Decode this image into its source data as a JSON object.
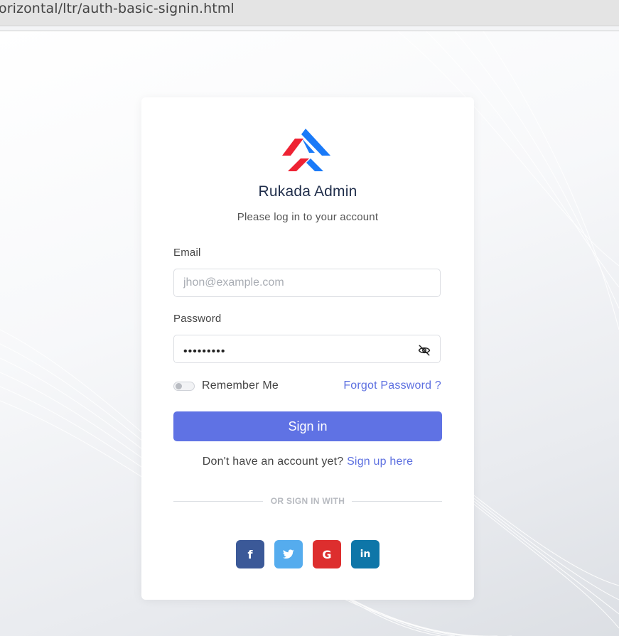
{
  "browser": {
    "url_fragment": "orizontal/ltr/auth-basic-signin.html"
  },
  "brand": {
    "name": "Rukada Admin",
    "tagline": "Please log in to your account",
    "logo_icon": "rukada-logo-icon",
    "colors": {
      "red": "#ee2233",
      "blue": "#1a7af8"
    }
  },
  "form": {
    "email_label": "Email",
    "email_placeholder": "jhon@example.com",
    "email_value": "",
    "password_label": "Password",
    "password_value": "•••••••••",
    "password_toggle_icon": "eye-slash-icon",
    "remember_label": "Remember Me",
    "remember_checked": false,
    "forgot_label": "Forgot Password ?",
    "submit_label": "Sign in",
    "signup_prompt": "Don't have an account yet?",
    "signup_link": "Sign up here"
  },
  "social": {
    "divider": "OR SIGN IN WITH",
    "buttons": [
      {
        "name": "facebook",
        "glyph": "f",
        "icon": "facebook-icon",
        "color": "#3b5998"
      },
      {
        "name": "twitter",
        "glyph": "",
        "icon": "twitter-icon",
        "color": "#55acee"
      },
      {
        "name": "google",
        "glyph": "G",
        "icon": "google-icon",
        "color": "#dd2e2e"
      },
      {
        "name": "linkedin",
        "glyph": "in",
        "icon": "linkedin-icon",
        "color": "#0e76a8"
      }
    ]
  },
  "colors": {
    "accent": "#5f72e4",
    "link": "#5c6fe0"
  }
}
